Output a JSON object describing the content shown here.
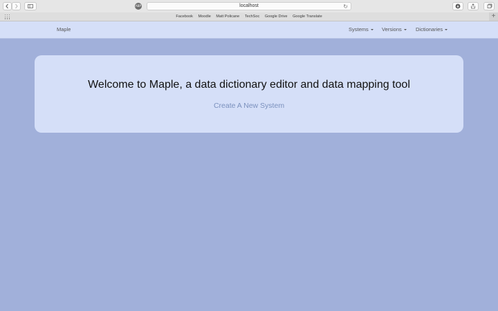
{
  "browser": {
    "address": "localhost",
    "bookmarks": [
      "Facebook",
      "Moodle",
      "Matt Policane",
      "TechSoc",
      "Google Drive",
      "Google Translate"
    ],
    "new_tab_symbol": "+"
  },
  "navbar": {
    "brand": "Maple",
    "menus": [
      {
        "label": "Systems"
      },
      {
        "label": "Versions"
      },
      {
        "label": "Dictionaries"
      }
    ]
  },
  "jumbotron": {
    "heading": "Welcome to Maple, a data dictionary editor and data mapping tool",
    "link": "Create A New System"
  },
  "colors": {
    "page_background": "#a1b0da",
    "panel_background": "#d5dff8",
    "link_color": "#7a90bd"
  }
}
